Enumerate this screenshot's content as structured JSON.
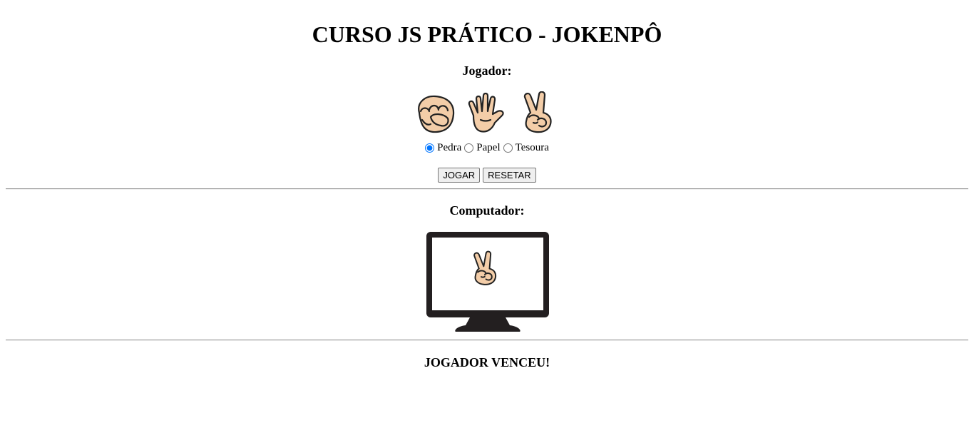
{
  "header": {
    "title": "CURSO JS PRÁTICO - JOKENPÔ"
  },
  "player": {
    "label": "Jogador:",
    "hands": [
      {
        "icon": "rock-hand-icon"
      },
      {
        "icon": "paper-hand-icon"
      },
      {
        "icon": "scissors-hand-icon"
      }
    ],
    "options": [
      {
        "label": "Pedra",
        "checked": true
      },
      {
        "label": "Papel",
        "checked": false
      },
      {
        "label": "Tesoura",
        "checked": false
      }
    ],
    "play_button": "JOGAR",
    "reset_button": "RESETAR"
  },
  "computer": {
    "label": "Computador:",
    "choice_icon": "scissors-hand-icon"
  },
  "result": {
    "text": "JOGADOR VENCEU!"
  },
  "colors": {
    "skin": "#f3cda8",
    "outline": "#222222",
    "monitor": "#231f20",
    "radio_accent": "#0075ff"
  }
}
